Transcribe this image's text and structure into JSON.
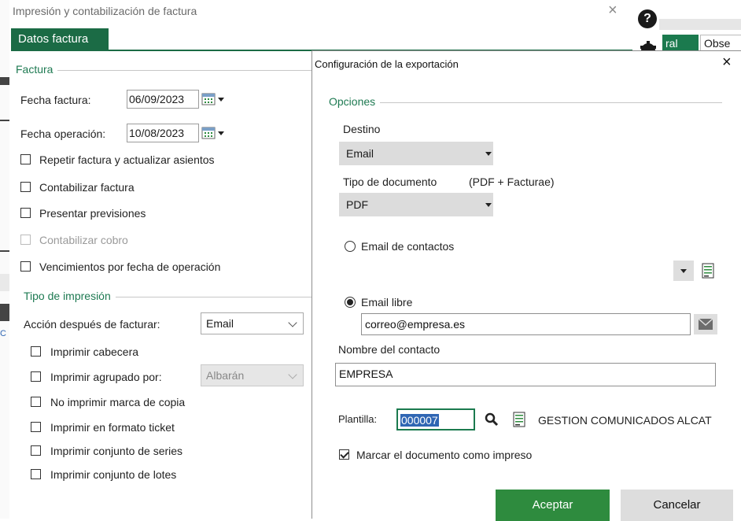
{
  "window": {
    "title": "Impresión y contabilización de factura",
    "close_glyph": "×",
    "help_glyph": "?",
    "tab_datos": "Datos factura",
    "right_tab_green": "ral",
    "right_tab_white": "Obse",
    "left_edge_text": "C"
  },
  "factura": {
    "group_title": "Factura",
    "fecha_factura_label": "Fecha factura:",
    "fecha_factura_value": "06/09/2023",
    "fecha_operacion_label": "Fecha operación:",
    "fecha_operacion_value": "10/08/2023",
    "options": [
      {
        "label": "Repetir factura y actualizar asientos",
        "checked": false,
        "enabled": true
      },
      {
        "label": "Contabilizar factura",
        "checked": false,
        "enabled": true
      },
      {
        "label": "Presentar previsiones",
        "checked": false,
        "enabled": true
      },
      {
        "label": "Contabilizar cobro",
        "checked": false,
        "enabled": false
      },
      {
        "label": "Vencimientos por fecha de operación",
        "checked": false,
        "enabled": true
      }
    ]
  },
  "impresion": {
    "group_title": "Tipo de impresión",
    "accion_label": "Acción después de facturar:",
    "accion_value": "Email",
    "options": [
      {
        "label": "Imprimir cabecera",
        "checked": false
      },
      {
        "label": "Imprimir agrupado por:",
        "checked": false
      },
      {
        "label": "No imprimir marca de copia",
        "checked": false
      },
      {
        "label": "Imprimir en formato ticket",
        "checked": false
      },
      {
        "label": "Imprimir conjunto de series",
        "checked": false
      },
      {
        "label": "Imprimir conjunto de lotes",
        "checked": false
      }
    ],
    "agrupado_value": "Albarán"
  },
  "dialog": {
    "title": "Configuración de la exportación",
    "close_glyph": "×",
    "opciones_title": "Opciones",
    "destino_label": "Destino",
    "destino_value": "Email",
    "tipo_doc_label": "Tipo de documento",
    "tipo_doc_hint": "(PDF + Facturae)",
    "tipo_doc_value": "PDF",
    "email_contactos_label": "Email de contactos",
    "email_libre_label": "Email libre",
    "email_libre_value": "correo@empresa.es",
    "nombre_contacto_label": "Nombre del contacto",
    "nombre_contacto_value": "EMPRESA",
    "plantilla_label": "Plantilla:",
    "plantilla_value": "000007",
    "plantilla_desc": "GESTION COMUNICADOS ALCAT",
    "marcar_label": "Marcar el documento como impreso",
    "aceptar_label": "Aceptar",
    "cancelar_label": "Cancelar"
  },
  "colors": {
    "brand_green": "#1b6b45",
    "accept_green": "#2e8b3e",
    "selection_blue": "#2f66b3"
  },
  "icons": [
    "calendar-icon",
    "search-icon",
    "document-icon",
    "envelope-icon",
    "gear-icon",
    "help-icon"
  ]
}
